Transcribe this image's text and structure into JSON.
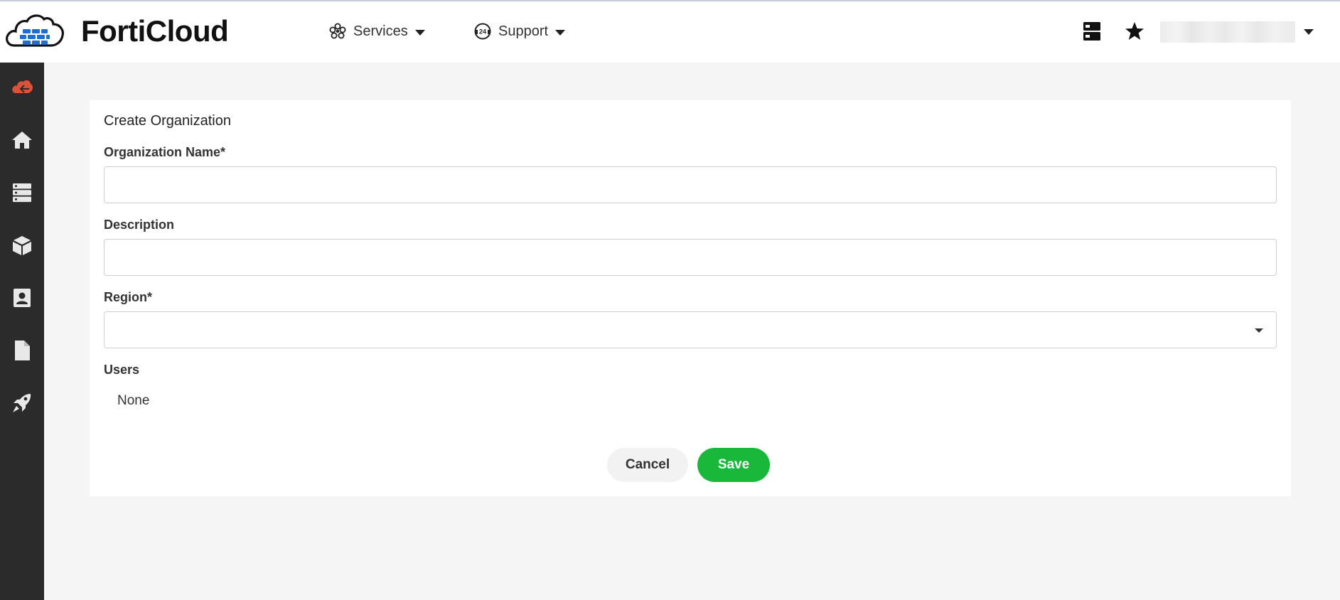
{
  "header": {
    "brand": "FortiCloud",
    "nav": [
      {
        "label": "Services",
        "icon": "services-icon"
      },
      {
        "label": "Support",
        "icon": "support-24-icon"
      }
    ],
    "icons": [
      "servers-icon",
      "star-icon"
    ],
    "account_label": ""
  },
  "sidebar": {
    "items": [
      {
        "name": "forticloud-logo-icon",
        "color": "#d9533a"
      },
      {
        "name": "home-icon"
      },
      {
        "name": "servers-icon"
      },
      {
        "name": "cube-icon"
      },
      {
        "name": "contact-card-icon"
      },
      {
        "name": "document-icon"
      },
      {
        "name": "rocket-icon"
      }
    ]
  },
  "form": {
    "title": "Create Organization",
    "org_name_label": "Organization Name*",
    "org_name_value": "",
    "description_label": "Description",
    "description_value": "",
    "region_label": "Region*",
    "region_value": "",
    "users_label": "Users",
    "users_value": "None",
    "cancel_label": "Cancel",
    "save_label": "Save"
  },
  "colors": {
    "save": "#1ab83a",
    "sidebar_bg": "#2b2b2b",
    "brand_blue": "#1f6fd1",
    "accent_red": "#d9533a"
  }
}
